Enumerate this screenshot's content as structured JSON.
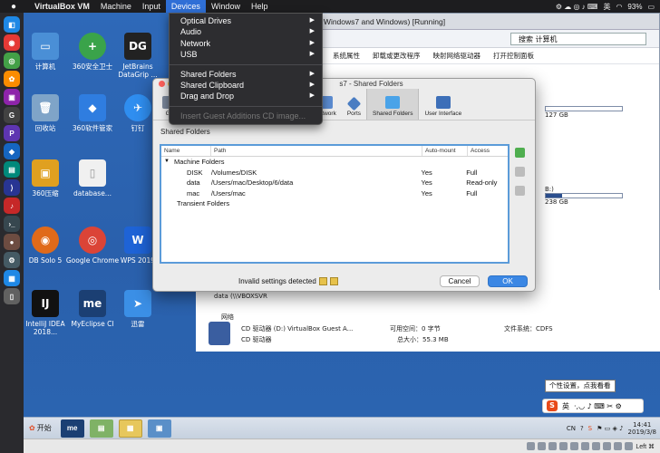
{
  "menubar": {
    "app": "VirtualBox VM",
    "items": [
      "Machine",
      "Input",
      "Devices",
      "Window",
      "Help"
    ],
    "active": "Devices",
    "status": {
      "battery": "93%",
      "ime": "英"
    }
  },
  "devices_menu": {
    "items": [
      {
        "label": "Optical Drives",
        "submenu": true,
        "disabled": false
      },
      {
        "label": "Audio",
        "submenu": true,
        "disabled": false
      },
      {
        "label": "Network",
        "submenu": true,
        "disabled": false
      },
      {
        "label": "USB",
        "submenu": true,
        "disabled": false
      },
      {
        "label": "Shared Folders",
        "submenu": true,
        "disabled": false
      },
      {
        "label": "Shared Clipboard",
        "submenu": true,
        "disabled": false
      },
      {
        "label": "Drag and Drop",
        "submenu": true,
        "disabled": false
      },
      {
        "label": "Insert Guest Additions CD image...",
        "submenu": false,
        "disabled": true
      }
    ]
  },
  "guest_window": {
    "title": "or Windows7 and Windows) [Running]",
    "search": "搜索 计算机",
    "toolbar": [
      "系统属性",
      "卸载或更改程序",
      "映射网络驱动器",
      "打开控制面板"
    ],
    "drive1_size": "127 GB",
    "drive2_label": "B:)",
    "drive2_size": "238 GB",
    "net_drive": "data (\\\\VBOXSVR",
    "net_label": "网络",
    "cd_name": "CD 驱动器 (D:) VirtualBox Guest A...",
    "cd_type": "CD 驱动器",
    "cd_free_label": "可用空间：0 字节",
    "cd_total_label": "总大小：55.3 MB",
    "cd_fs": "文件系统：CDFS"
  },
  "dialog": {
    "title": "s7 - Shared Folders",
    "toolbar": [
      "Ge",
      "Network",
      "Ports",
      "Shared Folders",
      "User Interface"
    ],
    "selected_tab": "Shared Folders",
    "section": "Shared Folders",
    "columns": [
      "Name",
      "Path",
      "Auto-mount",
      "Access"
    ],
    "group_machine": "Machine Folders",
    "group_transient": "Transient Folders",
    "folders": [
      {
        "name": "DISK",
        "path": "/Volumes/DISK",
        "automount": "Yes",
        "access": "Full"
      },
      {
        "name": "data",
        "path": "/Users/mac/Desktop/6/data",
        "automount": "Yes",
        "access": "Read-only"
      },
      {
        "name": "mac",
        "path": "/Users/mac",
        "automount": "Yes",
        "access": "Full"
      }
    ],
    "warning": "Invalid settings detected",
    "cancel": "Cancel",
    "ok": "OK"
  },
  "desktop_icons": [
    {
      "label": "计算机",
      "color": "#4a8fd6",
      "glyph": "▭"
    },
    {
      "label": "360安全卫士",
      "color": "#3aa34a",
      "glyph": "+"
    },
    {
      "label": "JetBrains DataGrip ...",
      "color": "#222222",
      "glyph": "DG"
    },
    {
      "label": "回收站",
      "color": "#7fa4c8",
      "glyph": "🗑"
    },
    {
      "label": "360软件管家",
      "color": "#2f7de0",
      "glyph": "◆"
    },
    {
      "label": "钉钉",
      "color": "#2f8ef0",
      "glyph": "✈"
    },
    {
      "label": "360压缩",
      "color": "#e0a020",
      "glyph": "▣"
    },
    {
      "label": "database...",
      "color": "#f0f0f0",
      "glyph": "▯"
    },
    {
      "label": "DB Solo 5",
      "color": "#e06a1a",
      "glyph": "◉"
    },
    {
      "label": "Google Chrome",
      "color": "#db4437",
      "glyph": "◎"
    },
    {
      "label": "WPS 2019",
      "color": "#1e63d6",
      "glyph": "W"
    },
    {
      "label": "IntelliJ IDEA 2018...",
      "color": "#111111",
      "glyph": "IJ"
    },
    {
      "label": "MyEclipse CI",
      "color": "#1b3f73",
      "glyph": "me"
    },
    {
      "label": "迅雷",
      "color": "#3b8fe6",
      "glyph": "➤"
    }
  ],
  "taskbar": {
    "start": "开始",
    "tray_lang": "CN",
    "time": "14:41",
    "date": "2019/3/8"
  },
  "tooltip": "个性设置，点我看看",
  "sogou": {
    "label": "英"
  },
  "vbstatus": "Left ⌘"
}
